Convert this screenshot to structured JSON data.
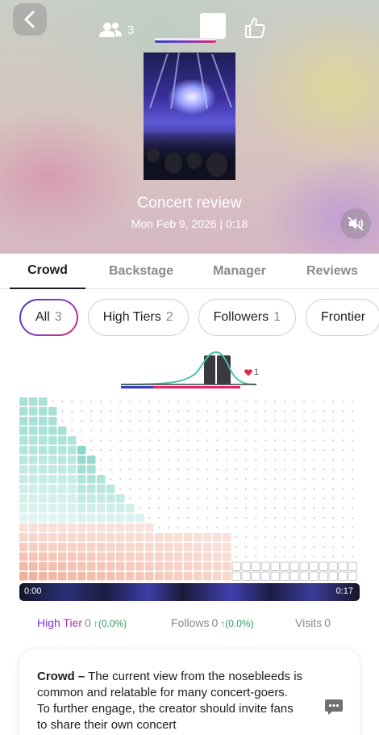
{
  "header": {
    "viewer_count": "3",
    "title": "Concert review",
    "date_duration": "Mon Feb 9, 2026 | 0:18"
  },
  "tabs": [
    {
      "label": "Crowd",
      "active": true
    },
    {
      "label": "Backstage",
      "active": false
    },
    {
      "label": "Manager",
      "active": false
    },
    {
      "label": "Reviews",
      "active": false
    }
  ],
  "chips": [
    {
      "label": "All",
      "count": "3",
      "active": true
    },
    {
      "label": "High Tiers",
      "count": "2",
      "active": false
    },
    {
      "label": "Followers",
      "count": "1",
      "active": false
    },
    {
      "label": "Frontier",
      "count": "",
      "active": false
    }
  ],
  "mini_chart": {
    "heart_count": "1"
  },
  "timeline": {
    "start": "0:00",
    "end": "0:17"
  },
  "stats": {
    "high_tier_label": "High Tier",
    "high_tier_value": "0",
    "high_tier_change": "↑(0.0%)",
    "follows_label": "Follows",
    "follows_value": "0",
    "follows_change": "↑(0.0%)",
    "visits_label": "Visits",
    "visits_value": "0"
  },
  "card": {
    "heading": "Crowd –",
    "body": " The current view from the nosebleeds is common and relatable for many concert-goers. To further engage, the creator should invite fans to share their own concert"
  },
  "colors": {
    "teal": "#5cc6b5",
    "peach": "#ed9e84",
    "gray_cell": "#dcdcdc",
    "accent_gradient": [
      "#3a3fb8",
      "#8b3cc8",
      "#e0286a"
    ]
  }
}
